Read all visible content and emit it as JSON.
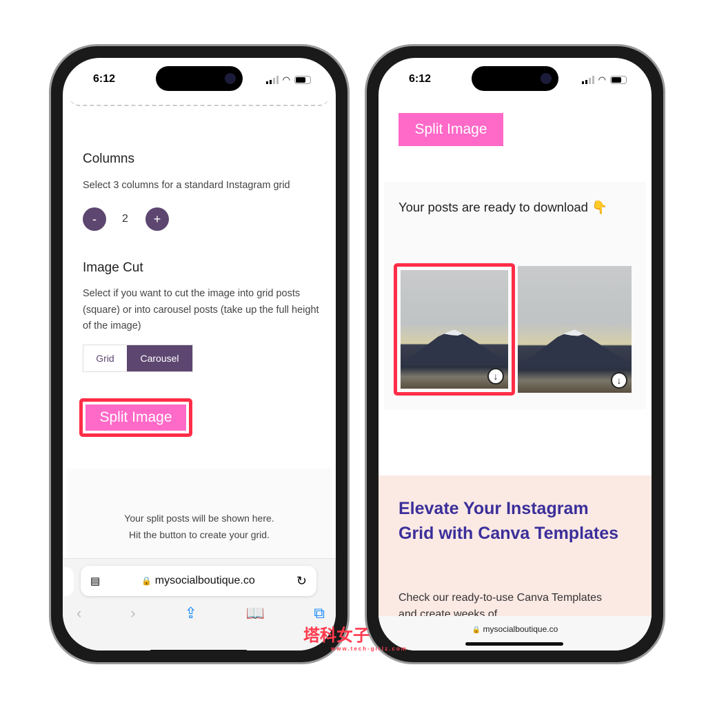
{
  "status": {
    "time": "6:12"
  },
  "left": {
    "columns": {
      "title": "Columns",
      "hint": "Select 3 columns for a standard Instagram grid",
      "minus": "-",
      "value": "2",
      "plus": "+"
    },
    "image_cut": {
      "title": "Image Cut",
      "hint": "Select if you want to cut the image into grid posts (square) or into carousel posts (take up the full height of the image)",
      "options": [
        "Grid",
        "Carousel"
      ],
      "selected": "Carousel"
    },
    "split_button": "Split Image",
    "placeholder": {
      "line1": "Your split posts will be shown here.",
      "line2": "Hit the button to create your grid."
    },
    "url": "mysocialboutique.co"
  },
  "right": {
    "split_button": "Split Image",
    "ready_text": "Your posts are ready to download 👇",
    "promo": {
      "title": "Elevate Your Instagram Grid with Canva Templates",
      "body": "Check our ready-to-use Canva Templates and create weeks of"
    },
    "url": "mysocialboutique.co"
  },
  "watermark": {
    "text": "塔科女子",
    "site": "www.tech-girlz.com"
  },
  "colors": {
    "accent": "#5d4670",
    "pink": "#ff69c8",
    "highlight": "#ff2d47",
    "promo_title": "#3b2f9a"
  }
}
